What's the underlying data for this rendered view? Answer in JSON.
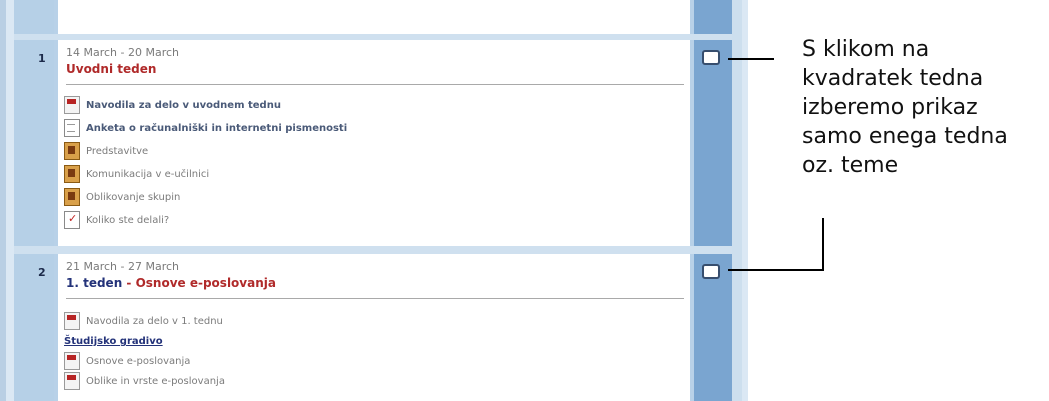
{
  "weeks": [
    {
      "number": "1",
      "date": "14 March - 20 March",
      "title_parts": [
        {
          "text": "Uvodni teden",
          "style": "red"
        }
      ],
      "items": [
        {
          "icon": "pdf-icon",
          "text": "Navodila za delo v uvodnem tednu",
          "bold": true
        },
        {
          "icon": "document-icon",
          "text": "Anketa o računalniški in internetni pismenosti",
          "bold": true
        },
        {
          "icon": "forum-icon",
          "text": "Predstavitve",
          "bold": false
        },
        {
          "icon": "forum-icon",
          "text": "Komunikacija v e-učilnici",
          "bold": false
        },
        {
          "icon": "forum-icon",
          "text": "Oblikovanje skupin",
          "bold": false
        },
        {
          "icon": "quiz-icon",
          "text": "Koliko ste delali?",
          "bold": false
        }
      ]
    },
    {
      "number": "2",
      "date": "21 March - 27 March",
      "title_parts": [
        {
          "text": "1. teden",
          "style": "blue"
        },
        {
          "text": " - ",
          "style": "red"
        },
        {
          "text": "Osnove e-poslovanja",
          "style": "red"
        }
      ],
      "items": [
        {
          "icon": "pdf-icon",
          "text": "Navodila za delo v 1. tednu",
          "bold": false
        }
      ],
      "sublink": "Študijsko gradivo",
      "sub_items": [
        {
          "icon": "pdf-icon",
          "text": "Osnove e-poslovanja"
        },
        {
          "icon": "pdf-icon",
          "text": "Oblike in vrste e-poslovanja"
        }
      ]
    }
  ],
  "annotation": {
    "lines": [
      "S klikom na",
      "kvadratek tedna",
      "izberemo prikaz",
      "samo enega tedna",
      "oz. teme"
    ]
  },
  "colors": {
    "frame": "#dbe8f4",
    "side_strip": "#7aa5d0",
    "title_red": "#b02a2a",
    "title_blue": "#233279"
  }
}
